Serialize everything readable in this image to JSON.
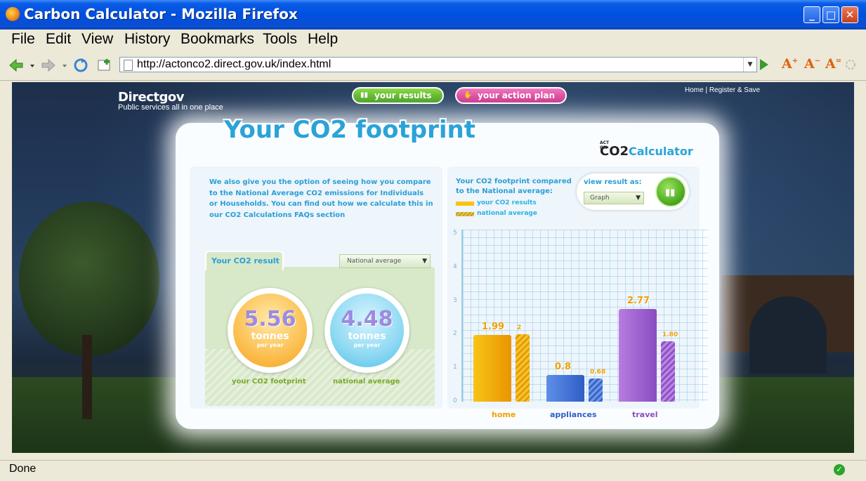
{
  "window": {
    "title": "Carbon Calculator - Mozilla Firefox"
  },
  "menu": [
    "File",
    "Edit",
    "View",
    "History",
    "Bookmarks",
    "Tools",
    "Help"
  ],
  "address_bar": {
    "url": "http://actonco2.direct.gov.uk/index.html"
  },
  "toolbar_icons": [
    "back-arrow-icon",
    "forward-arrow-icon",
    "reload-icon",
    "new-tab-icon",
    "go-icon",
    "font-increase-icon",
    "font-decrease-icon",
    "font-reset-icon",
    "throbber-icon"
  ],
  "site": {
    "logo": "Directgov",
    "tagline": "Public services all in one place",
    "nav": {
      "results": "your results",
      "action_plan": "your action plan"
    },
    "top_links": "Home | Register & Save",
    "title": "Your CO2 footprint",
    "calc_logo": {
      "act": "ACT ON",
      "co2": "CO2",
      "calc": "Calculator"
    }
  },
  "intro_text": "We also give you the option of seeing how you compare to the National Average CO2 emissions for Individuals or Households. You can find out how we calculate this in our CO2 Calculations FAQs section",
  "result_card": {
    "tab": "Your CO2 result",
    "compare_select": "National average",
    "your": {
      "value": "5.56",
      "unit": "tonnes",
      "per": "per year",
      "label": "your CO2 footprint"
    },
    "national": {
      "value": "4.48",
      "unit": "tonnes",
      "per": "per year",
      "label": "national average"
    }
  },
  "compare": {
    "title": "Your CO2 footprint compared to the National average:",
    "legend": {
      "your": "your CO2 results",
      "national": "national average"
    },
    "view_label": "view result as:",
    "view_select": "Graph"
  },
  "colors": {
    "brand_blue": "#2aa3d8",
    "green": "#79a92a",
    "home": "#f0a000",
    "appliances": "#2f5ec6",
    "travel": "#8a4dc2"
  },
  "chart_data": {
    "type": "bar",
    "categories": [
      "home",
      "appliances",
      "travel"
    ],
    "series": [
      {
        "name": "your CO2 results",
        "values": [
          1.99,
          0.8,
          2.77
        ],
        "labels": [
          "1.99",
          "0.8",
          "2.77"
        ]
      },
      {
        "name": "national average",
        "values": [
          2,
          0.68,
          1.8
        ],
        "labels": [
          "2",
          "0.68",
          "1.80"
        ]
      }
    ],
    "ylim": [
      0,
      5
    ],
    "yticks": [
      "0",
      "1",
      "2",
      "3",
      "4",
      "5"
    ],
    "grid": true
  },
  "status": {
    "text": "Done"
  }
}
